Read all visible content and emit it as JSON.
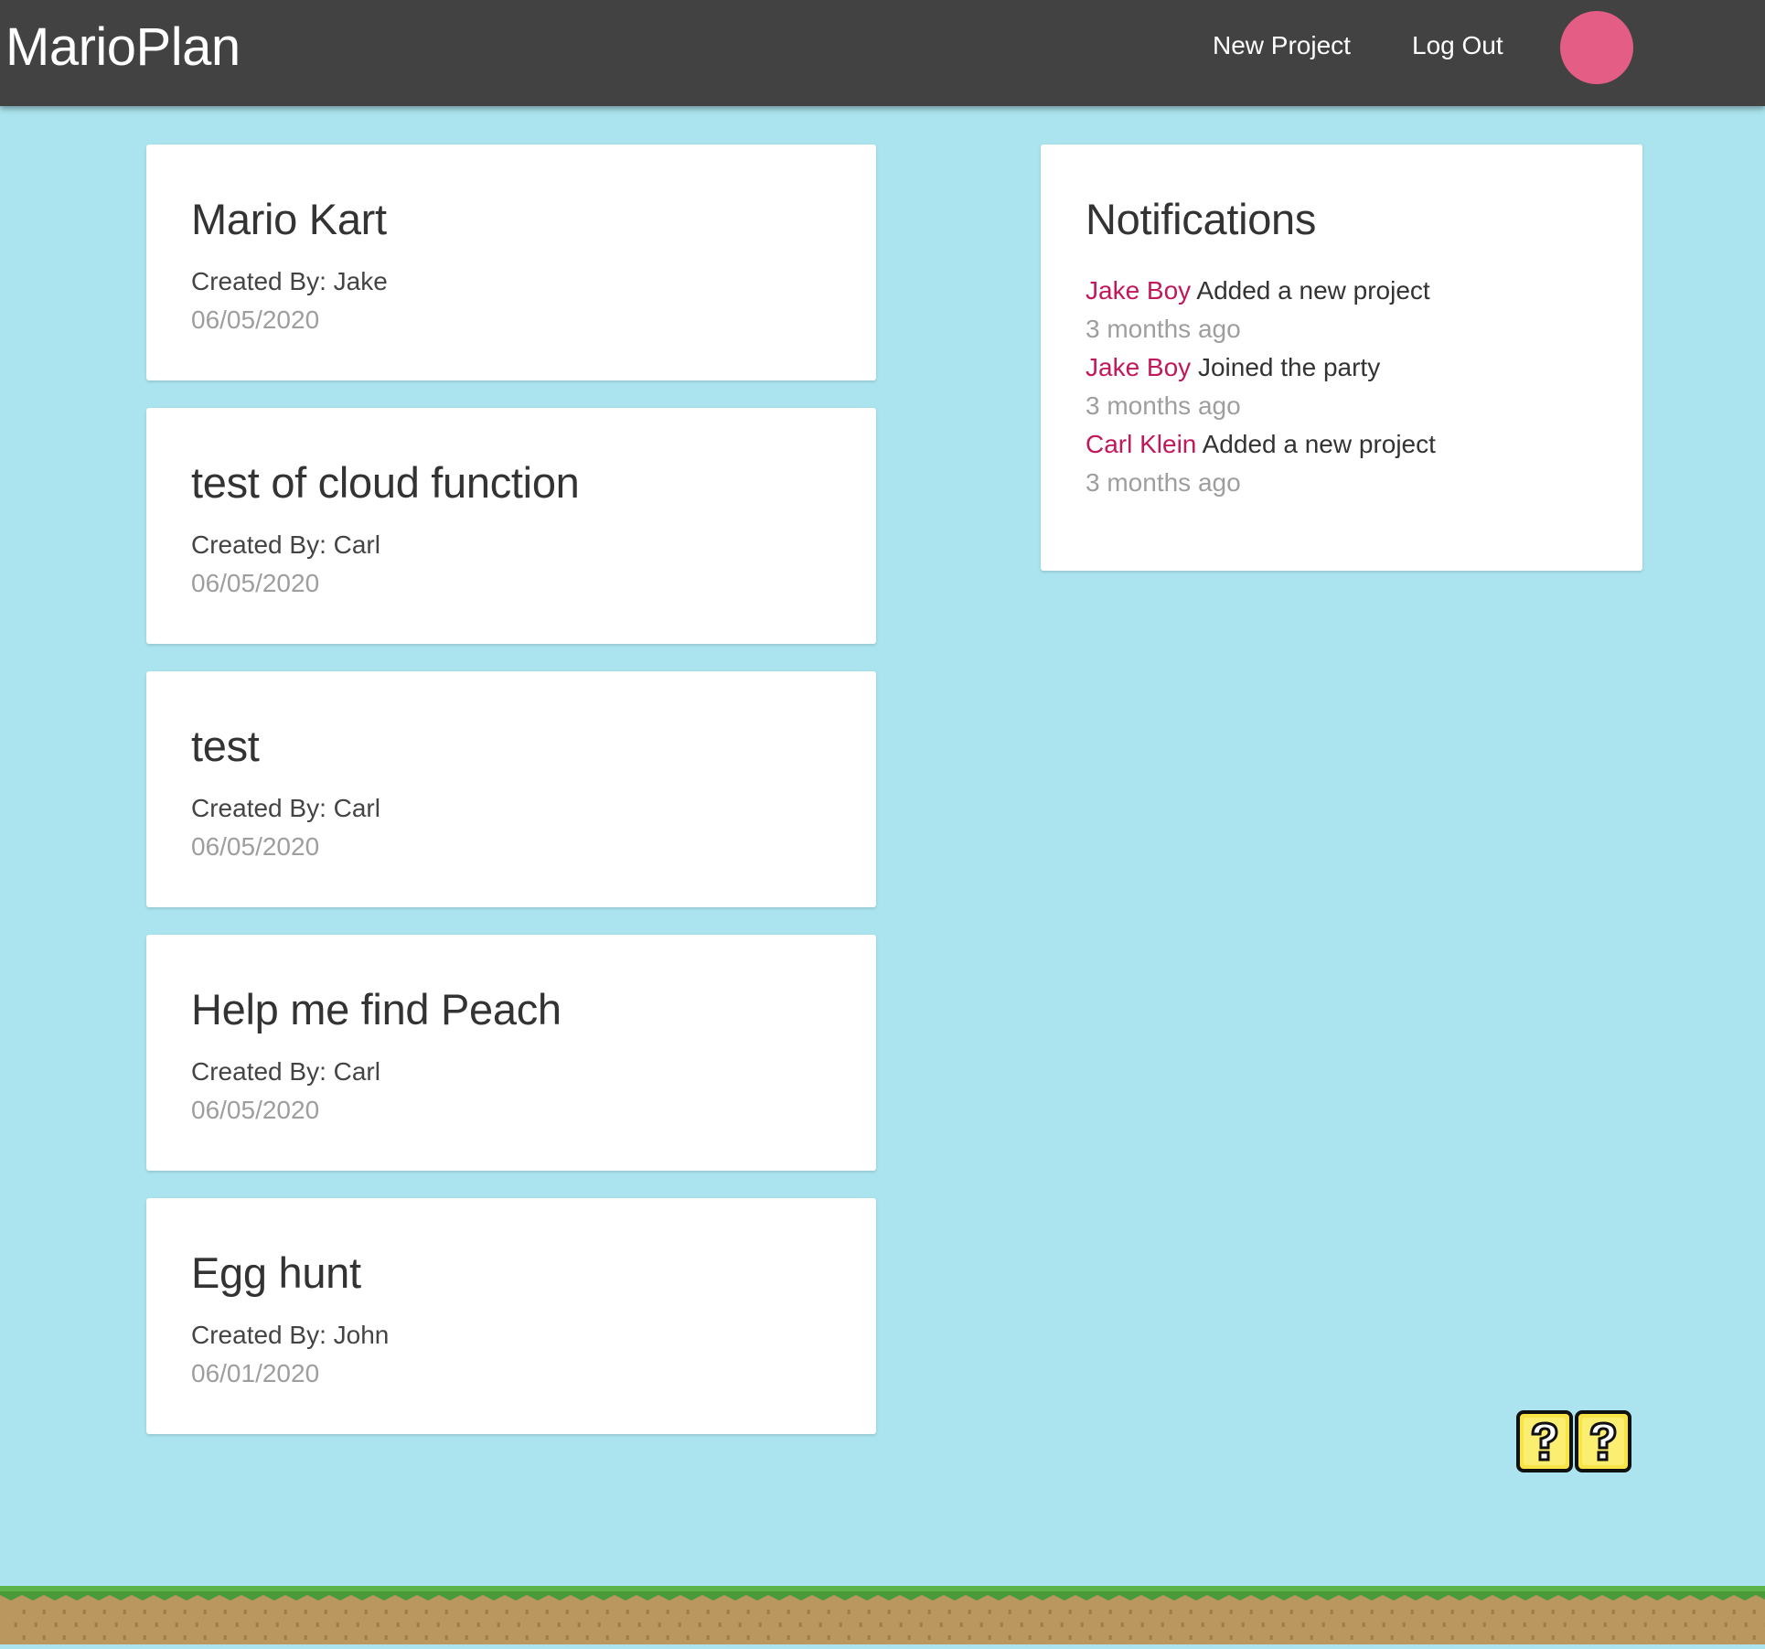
{
  "navbar": {
    "brand": "MarioPlan",
    "links": {
      "new_project": "New Project",
      "log_out": "Log Out"
    },
    "avatar_color": "#e35d84"
  },
  "projects": [
    {
      "title": "Mario Kart",
      "author": "Created By: Jake",
      "date": "06/05/2020"
    },
    {
      "title": "test of cloud function",
      "author": "Created By: Carl",
      "date": "06/05/2020"
    },
    {
      "title": "test",
      "author": "Created By: Carl",
      "date": "06/05/2020"
    },
    {
      "title": "Help me find Peach",
      "author": "Created By: Carl",
      "date": "06/05/2020"
    },
    {
      "title": "Egg hunt",
      "author": "Created By: John",
      "date": "06/01/2020"
    }
  ],
  "notifications": {
    "title": "Notifications",
    "items": [
      {
        "user": "Jake Boy",
        "content": "Added a new project",
        "time": "3 months ago"
      },
      {
        "user": "Jake Boy",
        "content": "Joined the party",
        "time": "3 months ago"
      },
      {
        "user": "Carl Klein",
        "content": "Added a new project",
        "time": "3 months ago"
      }
    ]
  },
  "colors": {
    "background": "#abe4ee",
    "navbar": "#424242",
    "accent_user": "#c2185b",
    "muted": "#9e9e9e",
    "grass": "#5cb34a",
    "dirt": "#b9975e"
  },
  "decorations": {
    "blocks_icon": "question-block-icon",
    "ground_icon": "ground-tiles"
  }
}
